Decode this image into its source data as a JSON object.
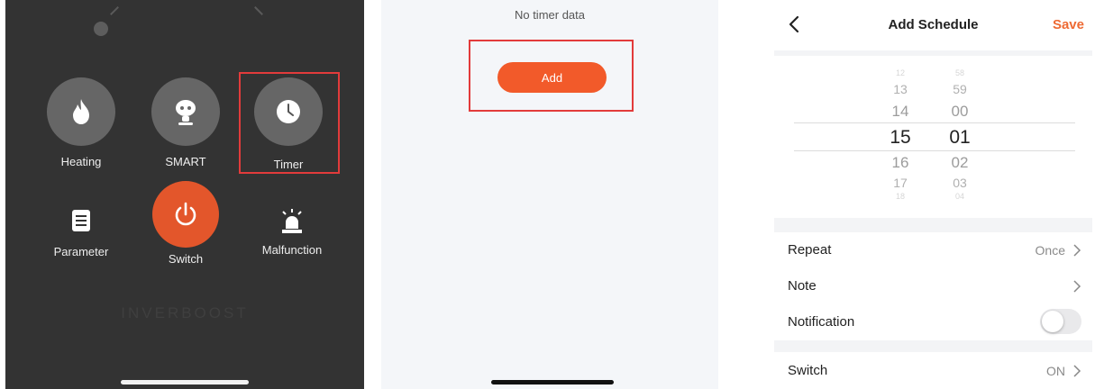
{
  "panel1": {
    "controls": [
      {
        "label": "Heating",
        "icon": "flame-icon"
      },
      {
        "label": "SMART",
        "icon": "robot-icon"
      },
      {
        "label": "Timer",
        "icon": "clock-icon"
      },
      {
        "label": "Parameter",
        "icon": "document-icon"
      },
      {
        "label": "Switch",
        "icon": "power-icon"
      },
      {
        "label": "Malfunction",
        "icon": "alarm-icon"
      }
    ],
    "brand": "INVERBOOST"
  },
  "panel2": {
    "empty_text": "No timer data",
    "add_label": "Add"
  },
  "panel3": {
    "nav": {
      "title": "Add Schedule",
      "save_label": "Save"
    },
    "picker": {
      "hours": [
        "12",
        "13",
        "14",
        "15",
        "16",
        "17",
        "18"
      ],
      "minutes": [
        "58",
        "59",
        "00",
        "01",
        "02",
        "03",
        "04"
      ],
      "selected_hour": "15",
      "selected_minute": "01"
    },
    "rows": {
      "repeat": {
        "label": "Repeat",
        "value": "Once"
      },
      "note": {
        "label": "Note"
      },
      "notification": {
        "label": "Notification",
        "enabled": false
      },
      "switch": {
        "label": "Switch",
        "value": "ON"
      }
    }
  },
  "colors": {
    "accent": "#f25a2a",
    "highlight": "#e23b3b",
    "dark_bg": "#333333"
  }
}
